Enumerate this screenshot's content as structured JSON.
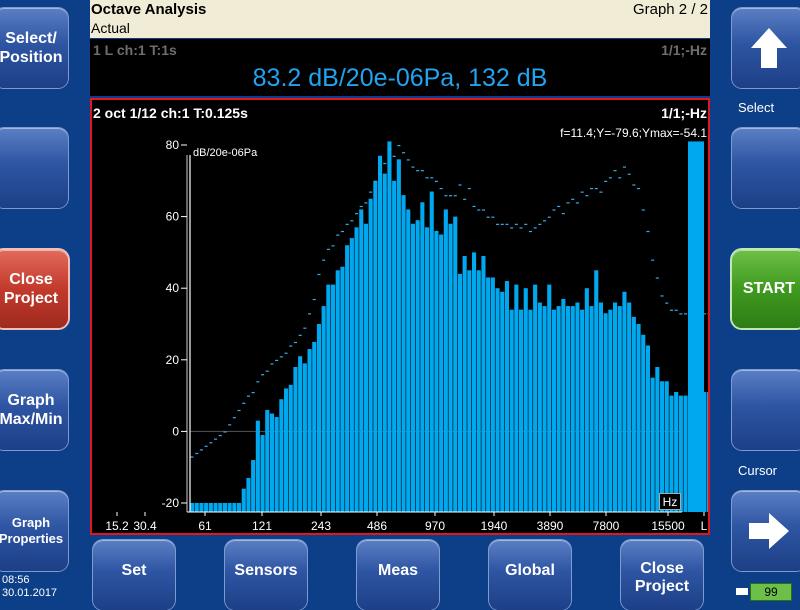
{
  "header": {
    "title": "Octave Analysis",
    "subtitle": "Actual",
    "graph_indicator": "Graph 2 / 2"
  },
  "readout": {
    "channel": "1 L ch:1 T:1s",
    "mode": "1/1;-Hz",
    "value": "83.2 dB/20e-06Pa, 132 dB"
  },
  "left_buttons": [
    {
      "label": "Select/\nPosition"
    },
    {
      "label": ""
    },
    {
      "label": "Close\nProject"
    },
    {
      "label": "Graph\nMax/Min"
    },
    {
      "label": "Graph\nProperties"
    }
  ],
  "right_buttons": {
    "up_icon": "arrow-up-icon",
    "up_label": "Select",
    "blank_label": "",
    "start_label": "START",
    "cursor_label": "Cursor",
    "right_icon": "arrow-right-icon"
  },
  "bottom_buttons": [
    {
      "label": "Set"
    },
    {
      "label": "Sensors"
    },
    {
      "label": "Meas"
    },
    {
      "label": "Global"
    },
    {
      "label": "Close\nProject"
    }
  ],
  "status": {
    "time": "08:56",
    "date": "30.01.2017",
    "counter": "99"
  },
  "colors": {
    "accent": "#21a3f0",
    "bar": "#00a8f0",
    "frame_border": "#e0181d",
    "start_green": "#3f9a20",
    "close_red": "#c23a2c"
  },
  "chart_data": {
    "type": "bar",
    "title": "2 oct 1/12 ch:1 T:0.125s",
    "mode_label": "1/1;-Hz",
    "cursor_text": "f=11.4;Y=-79.6;Ymax=-54.1",
    "ylabel": "dB/20e-06Pa",
    "xlabel": "Hz",
    "ylim": [
      -20,
      80
    ],
    "y_ticks": [
      80,
      60,
      40,
      20,
      0,
      -20
    ],
    "x_tick_labels": [
      "15.2",
      "30.4",
      "61",
      "121",
      "243",
      "486",
      "970",
      "1940",
      "3890",
      "7800",
      "15500",
      "L"
    ],
    "series": [
      {
        "values": [
          -20,
          -20,
          -20,
          -20,
          -20,
          -20,
          -20,
          -20,
          -20,
          -20,
          -20,
          -16,
          -13,
          -8,
          3,
          -1,
          6,
          5,
          4,
          9,
          12,
          13,
          18,
          21,
          19,
          23,
          25,
          30,
          35,
          41,
          41,
          45,
          46,
          52,
          54,
          57,
          62,
          58,
          65,
          70,
          77,
          72,
          81,
          70,
          76,
          66,
          62,
          58,
          59,
          64,
          57,
          67,
          56,
          55,
          62,
          58,
          60,
          44,
          49,
          45,
          50,
          45,
          49,
          43,
          43,
          40,
          39,
          42,
          34,
          41,
          34,
          40,
          34,
          41,
          36,
          35,
          41,
          34,
          35,
          37,
          35,
          35,
          36,
          34,
          40,
          35,
          45,
          36,
          33,
          34,
          36,
          35,
          39,
          36,
          32,
          30,
          27,
          24,
          15,
          18,
          14,
          14,
          10,
          11,
          10,
          10,
          10,
          10,
          10,
          11,
          11,
          12,
          12,
          12,
          13,
          13,
          13,
          14
        ],
        "max_values": [
          -7,
          -6,
          -5,
          -4,
          -3,
          -2,
          -1,
          0,
          2,
          4,
          6,
          8,
          10,
          11,
          14,
          16,
          17,
          19,
          20,
          21,
          22,
          24,
          25,
          27,
          29,
          33,
          37,
          44,
          48,
          51,
          52,
          55,
          56,
          58,
          59,
          61,
          63,
          64,
          67,
          70,
          72,
          75,
          79,
          77,
          80,
          78,
          76,
          74,
          73,
          73,
          71,
          71,
          70,
          68,
          66,
          66,
          66,
          69,
          65,
          68,
          63,
          62,
          62,
          60,
          60,
          58,
          58,
          58,
          57,
          58,
          57,
          58,
          56,
          57,
          58,
          59,
          60,
          62,
          63,
          61,
          64,
          65,
          64,
          67,
          66,
          68,
          68,
          67,
          70,
          71,
          73,
          71,
          74,
          72,
          69,
          68,
          62,
          56,
          48,
          43,
          38,
          36,
          34,
          34,
          33,
          33,
          33,
          33,
          34,
          33,
          33,
          34,
          34,
          33,
          34,
          34,
          33,
          34
        ],
        "total_bar": 81
      }
    ],
    "grid": false
  }
}
